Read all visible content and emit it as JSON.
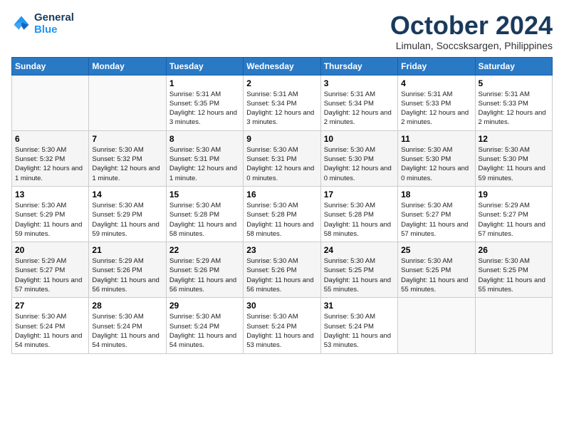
{
  "header": {
    "logo_line1": "General",
    "logo_line2": "Blue",
    "month_title": "October 2024",
    "location": "Limulan, Soccsksargen, Philippines"
  },
  "weekdays": [
    "Sunday",
    "Monday",
    "Tuesday",
    "Wednesday",
    "Thursday",
    "Friday",
    "Saturday"
  ],
  "weeks": [
    [
      {
        "day": null,
        "info": ""
      },
      {
        "day": null,
        "info": ""
      },
      {
        "day": "1",
        "info": "Sunrise: 5:31 AM\nSunset: 5:35 PM\nDaylight: 12 hours and 3 minutes."
      },
      {
        "day": "2",
        "info": "Sunrise: 5:31 AM\nSunset: 5:34 PM\nDaylight: 12 hours and 3 minutes."
      },
      {
        "day": "3",
        "info": "Sunrise: 5:31 AM\nSunset: 5:34 PM\nDaylight: 12 hours and 2 minutes."
      },
      {
        "day": "4",
        "info": "Sunrise: 5:31 AM\nSunset: 5:33 PM\nDaylight: 12 hours and 2 minutes."
      },
      {
        "day": "5",
        "info": "Sunrise: 5:31 AM\nSunset: 5:33 PM\nDaylight: 12 hours and 2 minutes."
      }
    ],
    [
      {
        "day": "6",
        "info": "Sunrise: 5:30 AM\nSunset: 5:32 PM\nDaylight: 12 hours and 1 minute."
      },
      {
        "day": "7",
        "info": "Sunrise: 5:30 AM\nSunset: 5:32 PM\nDaylight: 12 hours and 1 minute."
      },
      {
        "day": "8",
        "info": "Sunrise: 5:30 AM\nSunset: 5:31 PM\nDaylight: 12 hours and 1 minute."
      },
      {
        "day": "9",
        "info": "Sunrise: 5:30 AM\nSunset: 5:31 PM\nDaylight: 12 hours and 0 minutes."
      },
      {
        "day": "10",
        "info": "Sunrise: 5:30 AM\nSunset: 5:30 PM\nDaylight: 12 hours and 0 minutes."
      },
      {
        "day": "11",
        "info": "Sunrise: 5:30 AM\nSunset: 5:30 PM\nDaylight: 12 hours and 0 minutes."
      },
      {
        "day": "12",
        "info": "Sunrise: 5:30 AM\nSunset: 5:30 PM\nDaylight: 11 hours and 59 minutes."
      }
    ],
    [
      {
        "day": "13",
        "info": "Sunrise: 5:30 AM\nSunset: 5:29 PM\nDaylight: 11 hours and 59 minutes."
      },
      {
        "day": "14",
        "info": "Sunrise: 5:30 AM\nSunset: 5:29 PM\nDaylight: 11 hours and 59 minutes."
      },
      {
        "day": "15",
        "info": "Sunrise: 5:30 AM\nSunset: 5:28 PM\nDaylight: 11 hours and 58 minutes."
      },
      {
        "day": "16",
        "info": "Sunrise: 5:30 AM\nSunset: 5:28 PM\nDaylight: 11 hours and 58 minutes."
      },
      {
        "day": "17",
        "info": "Sunrise: 5:30 AM\nSunset: 5:28 PM\nDaylight: 11 hours and 58 minutes."
      },
      {
        "day": "18",
        "info": "Sunrise: 5:30 AM\nSunset: 5:27 PM\nDaylight: 11 hours and 57 minutes."
      },
      {
        "day": "19",
        "info": "Sunrise: 5:29 AM\nSunset: 5:27 PM\nDaylight: 11 hours and 57 minutes."
      }
    ],
    [
      {
        "day": "20",
        "info": "Sunrise: 5:29 AM\nSunset: 5:27 PM\nDaylight: 11 hours and 57 minutes."
      },
      {
        "day": "21",
        "info": "Sunrise: 5:29 AM\nSunset: 5:26 PM\nDaylight: 11 hours and 56 minutes."
      },
      {
        "day": "22",
        "info": "Sunrise: 5:29 AM\nSunset: 5:26 PM\nDaylight: 11 hours and 56 minutes."
      },
      {
        "day": "23",
        "info": "Sunrise: 5:30 AM\nSunset: 5:26 PM\nDaylight: 11 hours and 56 minutes."
      },
      {
        "day": "24",
        "info": "Sunrise: 5:30 AM\nSunset: 5:25 PM\nDaylight: 11 hours and 55 minutes."
      },
      {
        "day": "25",
        "info": "Sunrise: 5:30 AM\nSunset: 5:25 PM\nDaylight: 11 hours and 55 minutes."
      },
      {
        "day": "26",
        "info": "Sunrise: 5:30 AM\nSunset: 5:25 PM\nDaylight: 11 hours and 55 minutes."
      }
    ],
    [
      {
        "day": "27",
        "info": "Sunrise: 5:30 AM\nSunset: 5:24 PM\nDaylight: 11 hours and 54 minutes."
      },
      {
        "day": "28",
        "info": "Sunrise: 5:30 AM\nSunset: 5:24 PM\nDaylight: 11 hours and 54 minutes."
      },
      {
        "day": "29",
        "info": "Sunrise: 5:30 AM\nSunset: 5:24 PM\nDaylight: 11 hours and 54 minutes."
      },
      {
        "day": "30",
        "info": "Sunrise: 5:30 AM\nSunset: 5:24 PM\nDaylight: 11 hours and 53 minutes."
      },
      {
        "day": "31",
        "info": "Sunrise: 5:30 AM\nSunset: 5:24 PM\nDaylight: 11 hours and 53 minutes."
      },
      {
        "day": null,
        "info": ""
      },
      {
        "day": null,
        "info": ""
      }
    ]
  ]
}
